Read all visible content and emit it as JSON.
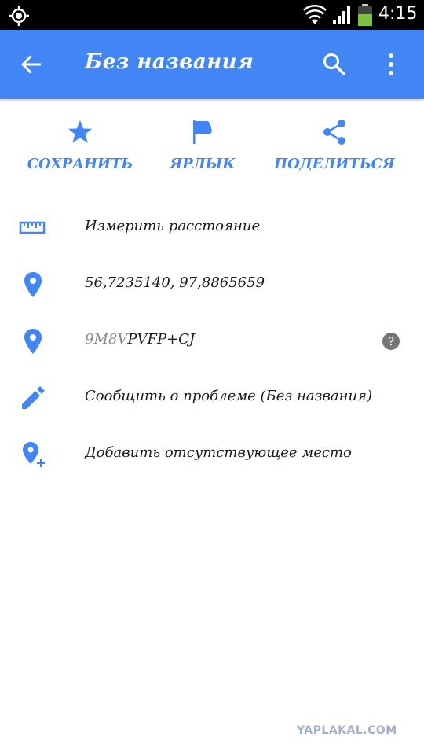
{
  "status_bar": {
    "time": "4:15",
    "icons": [
      "gps-icon",
      "wifi-icon",
      "signal-icon",
      "battery-icon"
    ],
    "battery_color": "#7cc242"
  },
  "app_bar": {
    "title": "Без названия",
    "background": "#4285f4",
    "icons": [
      "back-arrow-icon",
      "search-icon",
      "more-vert-icon"
    ]
  },
  "actions": [
    {
      "label": "СОХРАНИТЬ",
      "icon": "star-icon"
    },
    {
      "label": "ЯРЛЫК",
      "icon": "flag-icon"
    },
    {
      "label": "ПОДЕЛИТЬСЯ",
      "icon": "share-icon"
    }
  ],
  "accent_color": "#4285f4",
  "list": {
    "measure": {
      "label": "Измерить расстояние",
      "icon": "ruler-icon"
    },
    "coordinates": {
      "label": "56,7235140, 97,8865659",
      "icon": "place-icon"
    },
    "plus_code": {
      "prefix": "9M8V",
      "code": "PVFP+CJ",
      "icon": "place-icon",
      "help_icon": "help-icon"
    },
    "report": {
      "label": "Сообщить о проблеме (Без названия)",
      "icon": "edit-pencil-icon"
    },
    "add_place": {
      "label": "Добавить отсутствующее место",
      "icon": "add-location-icon"
    }
  },
  "watermark": "YAPLAKAL.COM"
}
